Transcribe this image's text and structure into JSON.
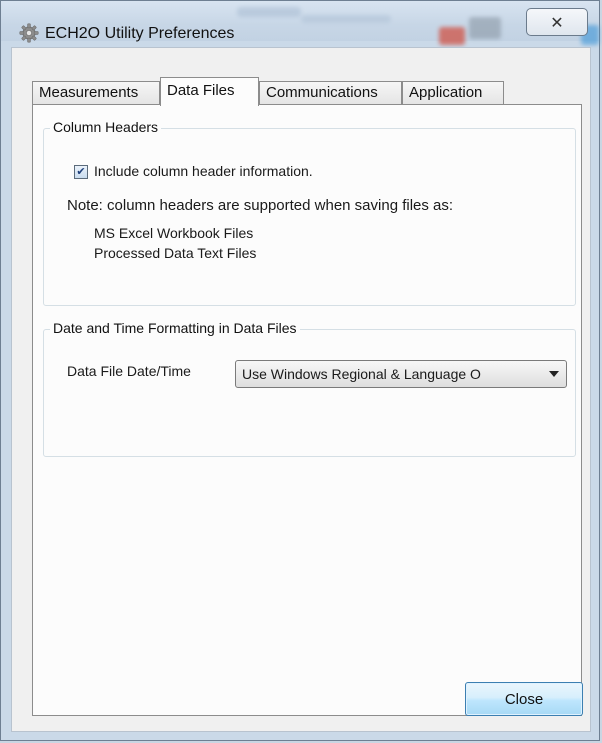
{
  "window": {
    "title": "ECH2O Utility Preferences",
    "close_glyph": "✕"
  },
  "tabs": [
    {
      "label": "Measurements",
      "active": false
    },
    {
      "label": "Data Files",
      "active": true
    },
    {
      "label": "Communications",
      "active": false
    },
    {
      "label": "Application",
      "active": false
    }
  ],
  "column_headers": {
    "legend": "Column Headers",
    "checkbox_label": "Include column header information.",
    "checked": true,
    "note": "Note: column headers are supported when saving files as:",
    "file_types": [
      "MS Excel Workbook Files",
      "Processed Data Text Files"
    ]
  },
  "date_time": {
    "legend": "Date and Time Formatting in Data Files",
    "label": "Data File Date/Time",
    "selected": "Use Windows Regional & Language O"
  },
  "buttons": {
    "close": "Close"
  },
  "colors": {
    "accent": "#3c7fb1",
    "window_frame": "#cad9e8"
  }
}
